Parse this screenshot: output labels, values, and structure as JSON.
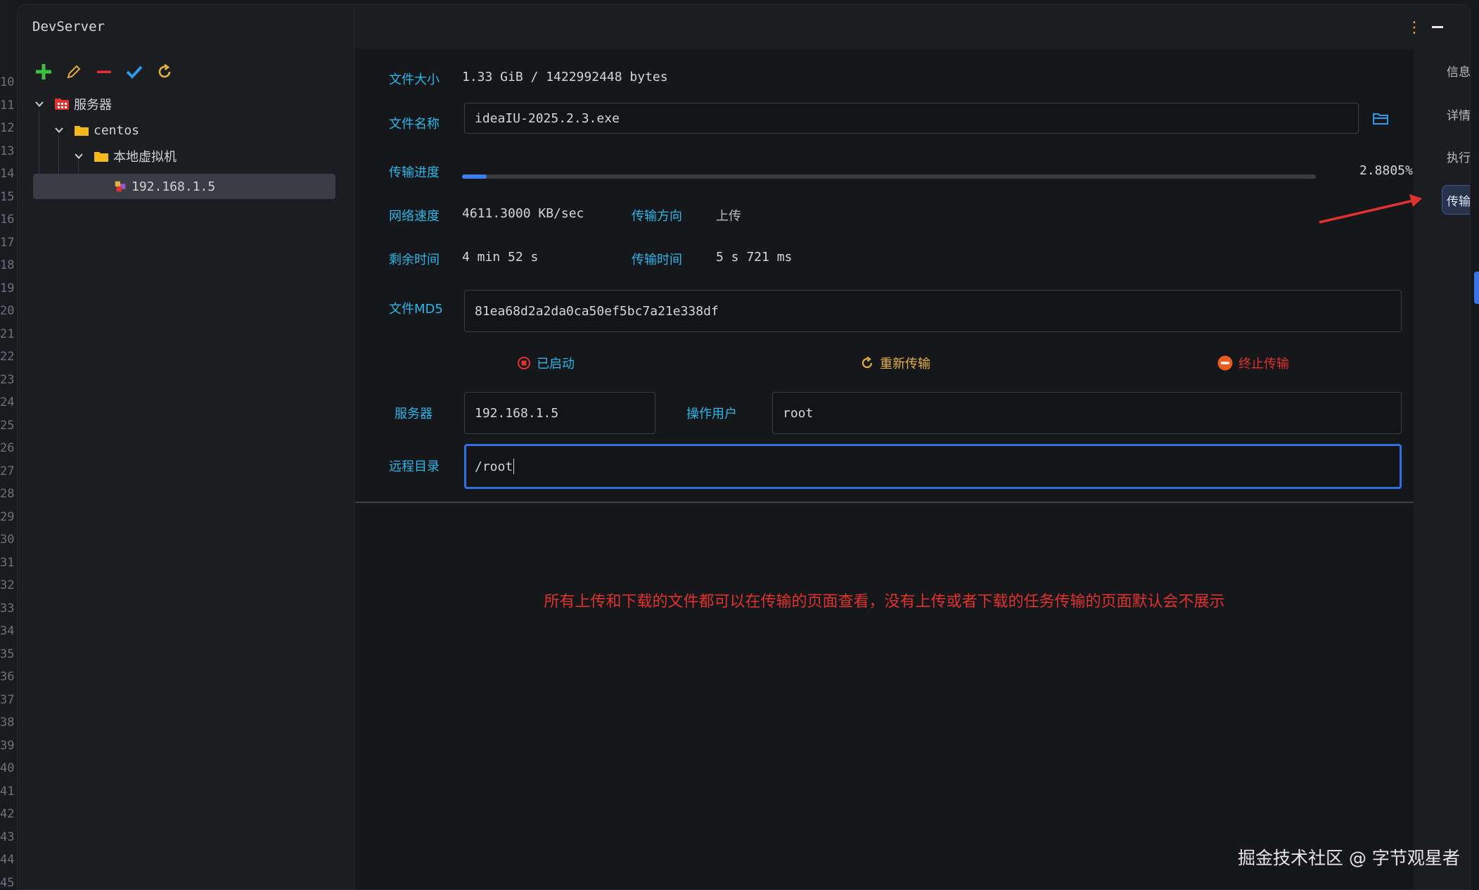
{
  "gutter_lines": [
    "10",
    "11",
    "12",
    "13",
    "14",
    "15",
    "16",
    "17",
    "18",
    "19",
    "20",
    "21",
    "22",
    "23",
    "24",
    "25",
    "26",
    "27",
    "28",
    "29",
    "30",
    "31",
    "32",
    "33",
    "34",
    "35",
    "36",
    "37",
    "38",
    "39",
    "40",
    "41",
    "42",
    "43",
    "44",
    "45"
  ],
  "window": {
    "title": "DevServer"
  },
  "toolbar": {
    "icons": [
      "plus-icon",
      "pencil-icon",
      "minus-icon",
      "check-icon",
      "refresh-icon"
    ],
    "colors": {
      "add": "#3fbf3f",
      "edit": "#e3a93a",
      "remove": "#e0322e",
      "confirm": "#2f9be8",
      "refresh": "#e3b341"
    }
  },
  "tree": {
    "root": {
      "label": "服务器"
    },
    "group": {
      "label": "centos"
    },
    "subgroup": {
      "label": "本地虚拟机"
    },
    "host": {
      "label": "192.168.1.5"
    }
  },
  "transfer": {
    "file_size_label": "文件大小",
    "file_size": "1.33 GiB / 1422992448 bytes",
    "file_name_label": "文件名称",
    "file_name": "ideaIU-2025.2.3.exe",
    "progress_label": "传输进度",
    "progress_percent": 2.8805,
    "progress_text": "2.8805%",
    "speed_label": "网络速度",
    "speed": "4611.3000 KB/sec",
    "direction_label": "传输方向",
    "direction": "上传",
    "remaining_label": "剩余时间",
    "remaining": "4 min 52 s",
    "elapsed_label": "传输时间",
    "elapsed": "5 s 721 ms",
    "md5_label": "文件MD5",
    "md5": "81ea68d2a2da0ca50ef5bc7a21e338df",
    "server_label": "服务器",
    "server": "192.168.1.5",
    "user_label": "操作用户",
    "user": "root",
    "remote_dir_label": "远程目录",
    "remote_dir": "/root"
  },
  "actions": {
    "started": "已启动",
    "retransmit": "重新传输",
    "terminate": "终止传输"
  },
  "note": "所有上传和下载的文件都可以在传输的页面查看，没有上传或者下载的任务传输的页面默认会不展示",
  "right_tabs": [
    "信息",
    "详情",
    "执行",
    "传输"
  ],
  "selected_tab": "传输",
  "watermark": "掘金技术社区 @ 字节观星者",
  "colors": {
    "label": "#2cb7e8",
    "accent": "#2f6fe6",
    "note": "#e0322e",
    "warning": "#e3b341",
    "danger": "#e0322e"
  }
}
